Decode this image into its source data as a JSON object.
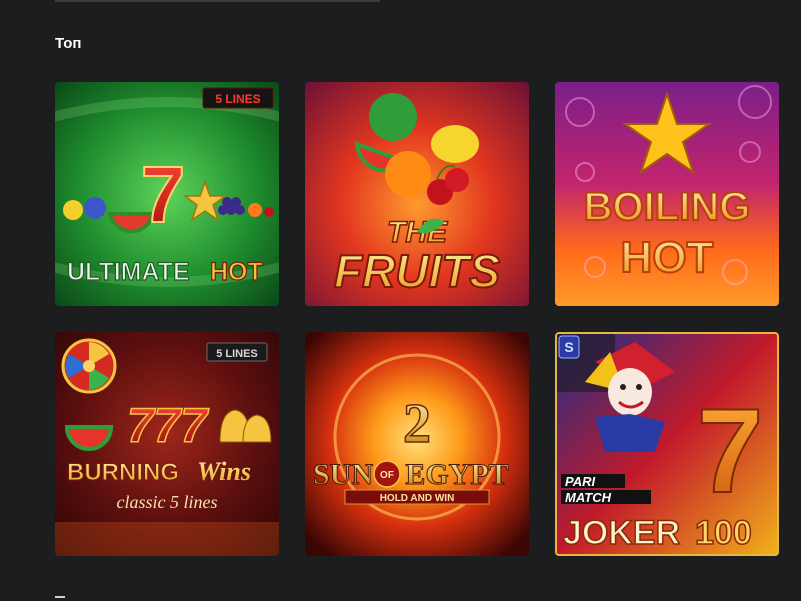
{
  "section": {
    "title": "Топ"
  },
  "games": [
    {
      "title_line1": "ULTIMATE",
      "title_line2": "HOT",
      "badge": "5 LINES",
      "seven": "7"
    },
    {
      "title_line1": "THE",
      "title_line2": "FRUITS"
    },
    {
      "title_line1": "BOILING",
      "title_line2": "HOT"
    },
    {
      "title_line1": "BURNING",
      "title_line2": "Wins",
      "subtitle": "classic 5 lines",
      "badge": "5 LINES",
      "sevens": "777"
    },
    {
      "number": "2",
      "title_line1": "SUN",
      "of": "OF",
      "title_line2": "EGYPT",
      "subtitle": "HOLD AND WIN"
    },
    {
      "brand_line1": "PARI",
      "brand_line2": "MATCH",
      "title_line1": "JOKER",
      "title_line2": "100",
      "seven": "7",
      "corner": "S"
    }
  ],
  "colors": {
    "background": "#1b1d1e",
    "title": "#ffffff",
    "accent_gold": "#f5c542",
    "ultimate_green": "#1f8f2f",
    "boiling_orange": "#ff7a1a"
  }
}
